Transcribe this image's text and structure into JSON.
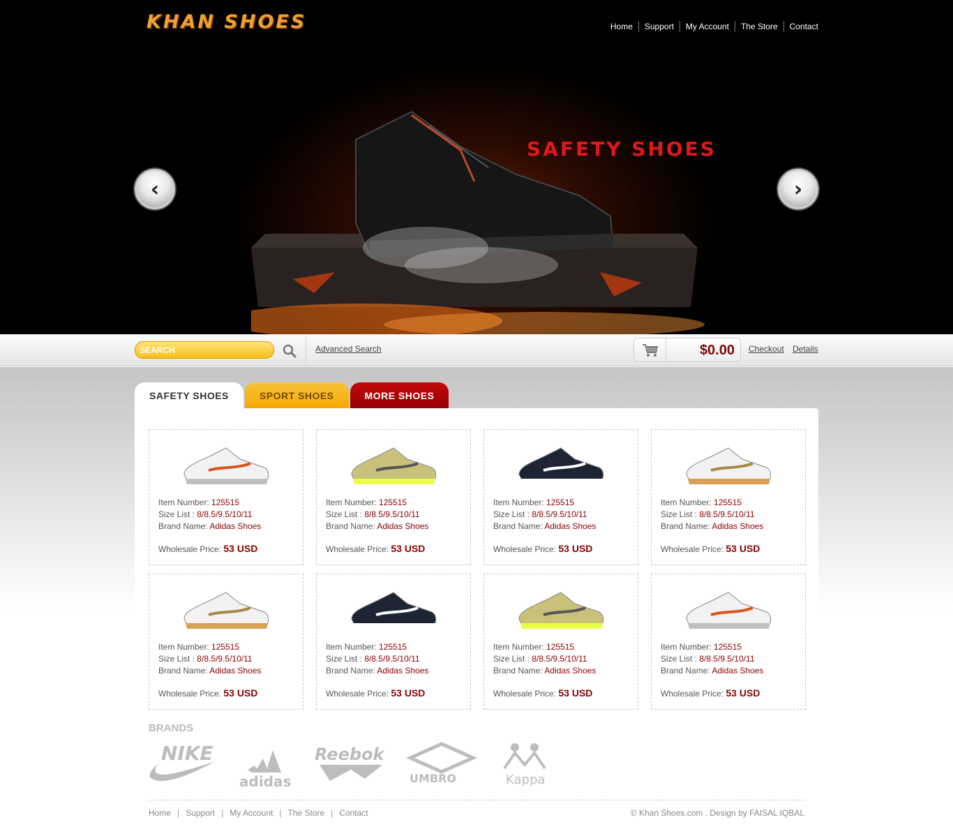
{
  "header": {
    "logo_text": "KHAN SHOES",
    "nav": [
      "Home",
      "Support",
      "My Account",
      "The Store",
      "Contact"
    ]
  },
  "hero": {
    "title": "SAFETY SHOES",
    "prev_icon": "chevron-left-icon",
    "next_icon": "chevron-right-icon"
  },
  "searchbar": {
    "search_placeholder": "SEARCH",
    "search_icon": "search-icon",
    "advanced_search": "Advanced Search",
    "cart_icon": "cart-icon",
    "cart_total": "$0.00",
    "checkout": "Checkout",
    "details": "Details"
  },
  "tabs": [
    "SAFETY SHOES",
    "SPORT SHOES",
    "MORE SHOES"
  ],
  "products": {
    "labels": {
      "item_number": "Item Number:",
      "size_list": "Size List :",
      "brand_name": "Brand Name:",
      "wholesale_price": "Wholesale Price:"
    },
    "items": [
      {
        "item_number": "125515",
        "size_list": "8/8.5/9.5/10/11",
        "brand_name": "Adidas Shoes",
        "price": "53 USD"
      },
      {
        "item_number": "125515",
        "size_list": "8/8.5/9.5/10/11",
        "brand_name": "Adidas Shoes",
        "price": "53 USD"
      },
      {
        "item_number": "125515",
        "size_list": "8/8.5/9.5/10/11",
        "brand_name": "Adidas Shoes",
        "price": "53 USD"
      },
      {
        "item_number": "125515",
        "size_list": "8/8.5/9.5/10/11",
        "brand_name": "Adidas Shoes",
        "price": "53 USD"
      },
      {
        "item_number": "125515",
        "size_list": "8/8.5/9.5/10/11",
        "brand_name": "Adidas Shoes",
        "price": "53 USD"
      },
      {
        "item_number": "125515",
        "size_list": "8/8.5/9.5/10/11",
        "brand_name": "Adidas Shoes",
        "price": "53 USD"
      },
      {
        "item_number": "125515",
        "size_list": "8/8.5/9.5/10/11",
        "brand_name": "Adidas Shoes",
        "price": "53 USD"
      },
      {
        "item_number": "125515",
        "size_list": "8/8.5/9.5/10/11",
        "brand_name": "Adidas Shoes",
        "price": "53 USD"
      }
    ]
  },
  "brands": {
    "title": "BRANDS",
    "logos": [
      "NIKE",
      "adidas",
      "Reebok",
      "UMBRO",
      "Kappa"
    ]
  },
  "footer": {
    "nav": [
      "Home",
      "Support",
      "My Account",
      "The Store",
      "Contact"
    ],
    "copyright": "© Khan Shoes.com . Design by FAISAL IQBAL"
  },
  "colors": {
    "accent_red": "#8a0000",
    "accent_yellow": "#f6bf1a",
    "hero_title": "#e01818"
  }
}
